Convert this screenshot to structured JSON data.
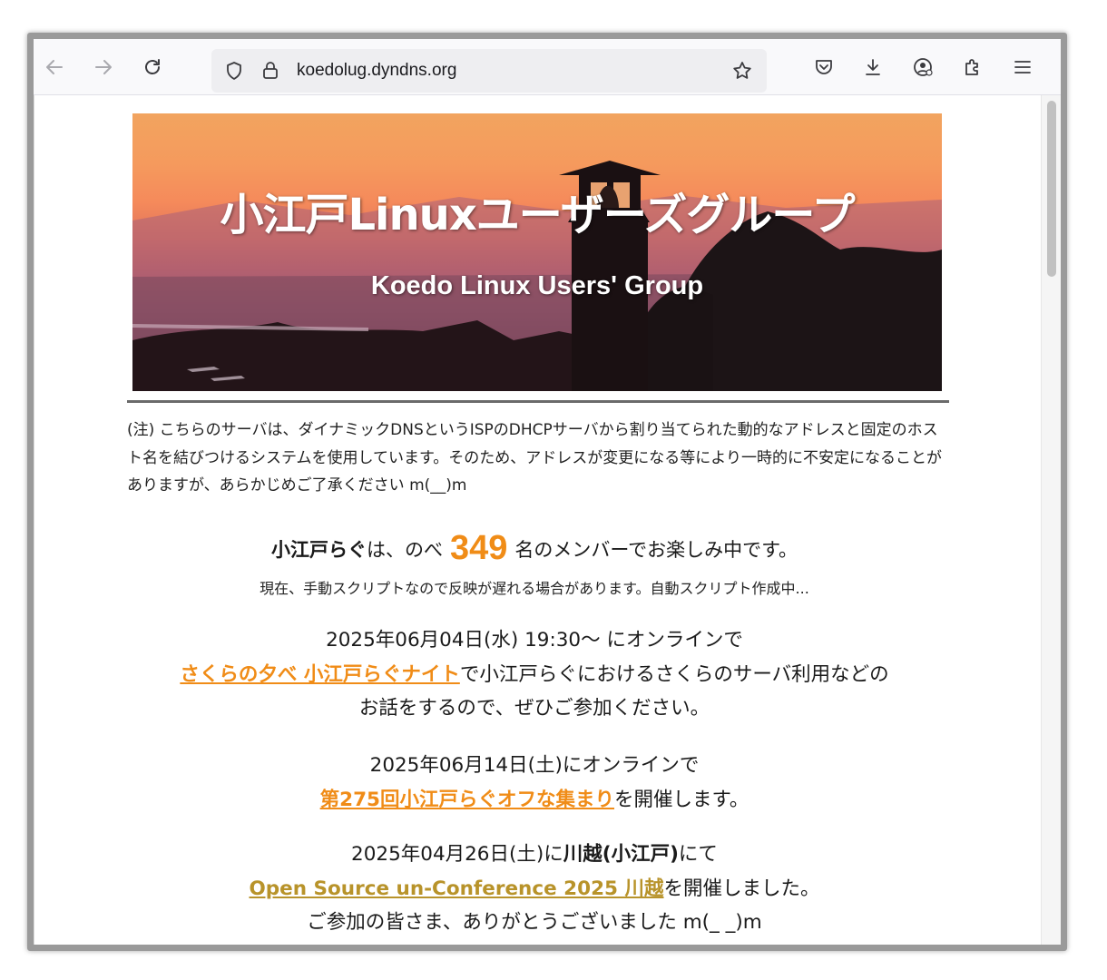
{
  "browser": {
    "url": "koedolug.dyndns.org"
  },
  "banner": {
    "title": "小江戸Linuxユーザーズグループ",
    "subtitle": "Koedo Linux Users' Group"
  },
  "note": {
    "text": "(注) こちらのサーバは、ダイナミックDNSというISPのDHCPサーバから割り当てられた動的なアドレスと固定のホスト名を結びつけるシステムを使用しています。そのため、アドレスが変更になる等により一時的に不安定になることがありますが、あらかじめご了承ください m(__)m"
  },
  "members": {
    "name": "小江戸らぐ",
    "prefix": "は、のべ",
    "count": "349",
    "suffix": "名のメンバーでお楽しみ中です。",
    "note": "現在、手動スクリプトなので反映が遅れる場合があります。自動スクリプト作成中..."
  },
  "events": {
    "e1": {
      "date": "2025年06月04日(水) 19:30〜 にオンラインで",
      "link": "さくらの夕べ 小江戸らぐナイト",
      "after": "で小江戸らぐにおけるさくらのサーバ利用などの",
      "line3": "お話をするので、ぜひご参加ください。"
    },
    "e2": {
      "date": "2025年06月14日(土)にオンラインで",
      "link": "第275回小江戸らぐオフな集まり",
      "after": "を開催します。"
    },
    "e3": {
      "date_a": "2025年04月26日(土)に",
      "place": "川越(小江戸)",
      "date_b": "にて",
      "link": "Open Source un-Conference 2025 川越",
      "after": "を開催しました。",
      "line3": "ご参加の皆さま、ありがとうございました m(_ _)m"
    }
  },
  "colors": {
    "link_orange": "#f08c17",
    "link_gold": "#b8932a"
  }
}
